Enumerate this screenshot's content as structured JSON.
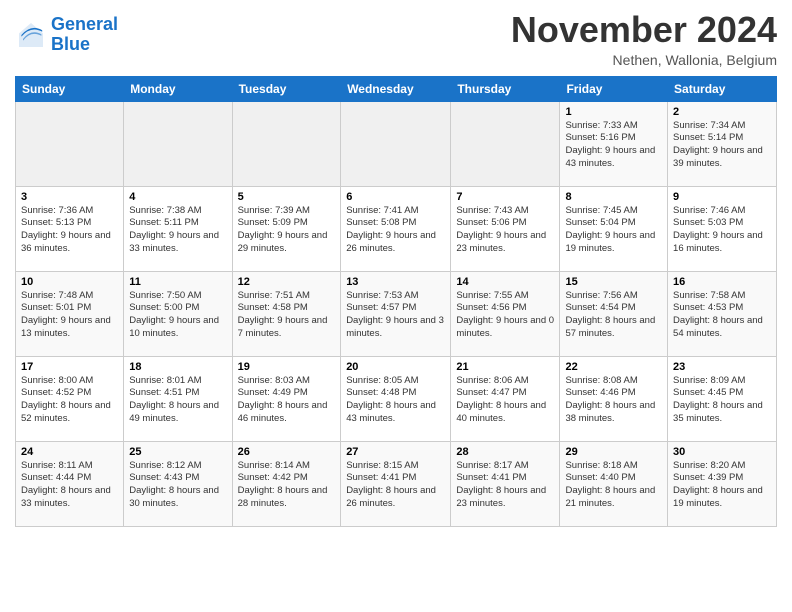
{
  "logo": {
    "line1": "General",
    "line2": "Blue"
  },
  "title": "November 2024",
  "subtitle": "Nethen, Wallonia, Belgium",
  "days_header": [
    "Sunday",
    "Monday",
    "Tuesday",
    "Wednesday",
    "Thursday",
    "Friday",
    "Saturday"
  ],
  "weeks": [
    [
      {
        "day": "",
        "info": ""
      },
      {
        "day": "",
        "info": ""
      },
      {
        "day": "",
        "info": ""
      },
      {
        "day": "",
        "info": ""
      },
      {
        "day": "",
        "info": ""
      },
      {
        "day": "1",
        "info": "Sunrise: 7:33 AM\nSunset: 5:16 PM\nDaylight: 9 hours and 43 minutes."
      },
      {
        "day": "2",
        "info": "Sunrise: 7:34 AM\nSunset: 5:14 PM\nDaylight: 9 hours and 39 minutes."
      }
    ],
    [
      {
        "day": "3",
        "info": "Sunrise: 7:36 AM\nSunset: 5:13 PM\nDaylight: 9 hours and 36 minutes."
      },
      {
        "day": "4",
        "info": "Sunrise: 7:38 AM\nSunset: 5:11 PM\nDaylight: 9 hours and 33 minutes."
      },
      {
        "day": "5",
        "info": "Sunrise: 7:39 AM\nSunset: 5:09 PM\nDaylight: 9 hours and 29 minutes."
      },
      {
        "day": "6",
        "info": "Sunrise: 7:41 AM\nSunset: 5:08 PM\nDaylight: 9 hours and 26 minutes."
      },
      {
        "day": "7",
        "info": "Sunrise: 7:43 AM\nSunset: 5:06 PM\nDaylight: 9 hours and 23 minutes."
      },
      {
        "day": "8",
        "info": "Sunrise: 7:45 AM\nSunset: 5:04 PM\nDaylight: 9 hours and 19 minutes."
      },
      {
        "day": "9",
        "info": "Sunrise: 7:46 AM\nSunset: 5:03 PM\nDaylight: 9 hours and 16 minutes."
      }
    ],
    [
      {
        "day": "10",
        "info": "Sunrise: 7:48 AM\nSunset: 5:01 PM\nDaylight: 9 hours and 13 minutes."
      },
      {
        "day": "11",
        "info": "Sunrise: 7:50 AM\nSunset: 5:00 PM\nDaylight: 9 hours and 10 minutes."
      },
      {
        "day": "12",
        "info": "Sunrise: 7:51 AM\nSunset: 4:58 PM\nDaylight: 9 hours and 7 minutes."
      },
      {
        "day": "13",
        "info": "Sunrise: 7:53 AM\nSunset: 4:57 PM\nDaylight: 9 hours and 3 minutes."
      },
      {
        "day": "14",
        "info": "Sunrise: 7:55 AM\nSunset: 4:56 PM\nDaylight: 9 hours and 0 minutes."
      },
      {
        "day": "15",
        "info": "Sunrise: 7:56 AM\nSunset: 4:54 PM\nDaylight: 8 hours and 57 minutes."
      },
      {
        "day": "16",
        "info": "Sunrise: 7:58 AM\nSunset: 4:53 PM\nDaylight: 8 hours and 54 minutes."
      }
    ],
    [
      {
        "day": "17",
        "info": "Sunrise: 8:00 AM\nSunset: 4:52 PM\nDaylight: 8 hours and 52 minutes."
      },
      {
        "day": "18",
        "info": "Sunrise: 8:01 AM\nSunset: 4:51 PM\nDaylight: 8 hours and 49 minutes."
      },
      {
        "day": "19",
        "info": "Sunrise: 8:03 AM\nSunset: 4:49 PM\nDaylight: 8 hours and 46 minutes."
      },
      {
        "day": "20",
        "info": "Sunrise: 8:05 AM\nSunset: 4:48 PM\nDaylight: 8 hours and 43 minutes."
      },
      {
        "day": "21",
        "info": "Sunrise: 8:06 AM\nSunset: 4:47 PM\nDaylight: 8 hours and 40 minutes."
      },
      {
        "day": "22",
        "info": "Sunrise: 8:08 AM\nSunset: 4:46 PM\nDaylight: 8 hours and 38 minutes."
      },
      {
        "day": "23",
        "info": "Sunrise: 8:09 AM\nSunset: 4:45 PM\nDaylight: 8 hours and 35 minutes."
      }
    ],
    [
      {
        "day": "24",
        "info": "Sunrise: 8:11 AM\nSunset: 4:44 PM\nDaylight: 8 hours and 33 minutes."
      },
      {
        "day": "25",
        "info": "Sunrise: 8:12 AM\nSunset: 4:43 PM\nDaylight: 8 hours and 30 minutes."
      },
      {
        "day": "26",
        "info": "Sunrise: 8:14 AM\nSunset: 4:42 PM\nDaylight: 8 hours and 28 minutes."
      },
      {
        "day": "27",
        "info": "Sunrise: 8:15 AM\nSunset: 4:41 PM\nDaylight: 8 hours and 26 minutes."
      },
      {
        "day": "28",
        "info": "Sunrise: 8:17 AM\nSunset: 4:41 PM\nDaylight: 8 hours and 23 minutes."
      },
      {
        "day": "29",
        "info": "Sunrise: 8:18 AM\nSunset: 4:40 PM\nDaylight: 8 hours and 21 minutes."
      },
      {
        "day": "30",
        "info": "Sunrise: 8:20 AM\nSunset: 4:39 PM\nDaylight: 8 hours and 19 minutes."
      }
    ]
  ]
}
